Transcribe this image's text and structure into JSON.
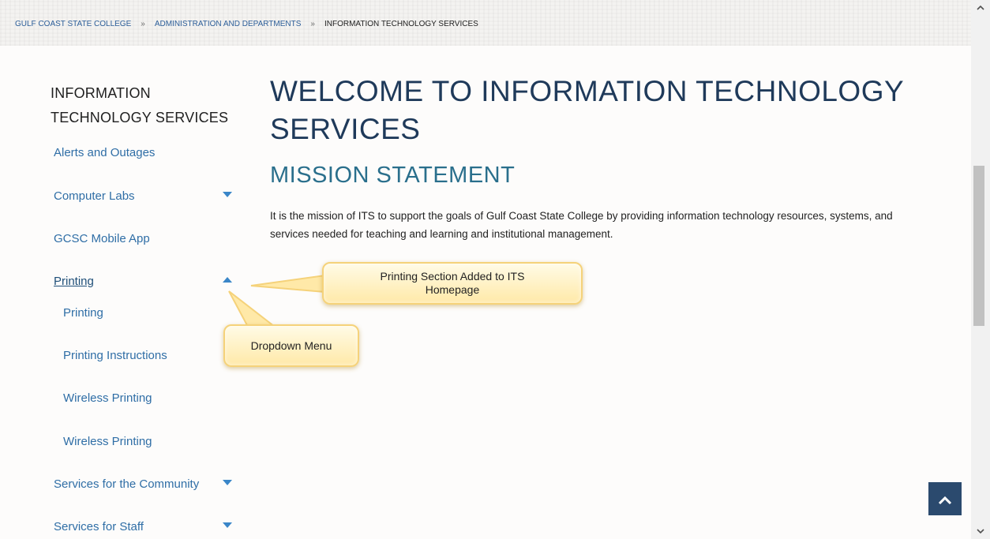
{
  "breadcrumb": {
    "items": [
      "GULF COAST STATE COLLEGE",
      "ADMINISTRATION AND DEPARTMENTS",
      "INFORMATION TECHNOLOGY SERVICES"
    ],
    "separator": "»"
  },
  "sidebar": {
    "title_line1": "INFORMATION",
    "title_line2": "TECHNOLOGY SERVICES",
    "items": [
      {
        "label": "Alerts and Outages"
      },
      {
        "label": "Computer Labs",
        "caret": "chevron-down-icon"
      },
      {
        "label": "GCSC Mobile App"
      },
      {
        "label": "Printing",
        "caret": "chevron-up-icon",
        "expanded": true
      },
      {
        "label": "Services for the Community",
        "caret": "chevron-down-icon"
      },
      {
        "label": "Services for Staff",
        "caret": "chevron-down-icon"
      }
    ],
    "subitems": [
      "Printing",
      "Printing Instructions",
      "Wireless Printing",
      "Wireless Printing"
    ]
  },
  "main": {
    "title": "WELCOME TO INFORMATION TECHNOLOGY SERVICES",
    "section_title": "MISSION STATEMENT",
    "mission_text": "It is the mission of ITS to support the goals of Gulf Coast State College by providing information technology resources, systems, and services needed for teaching and learning and institutional management."
  },
  "callouts": {
    "printing_section": "Printing Section Added to ITS Homepage",
    "dropdown": "Dropdown Menu"
  },
  "controls": {
    "back_to_top_icon": "chevron-up-icon",
    "scroll_up_icon": "scroll-up-arrow-icon",
    "scroll_down_icon": "scroll-down-arrow-icon"
  },
  "colors": {
    "link": "#2f6ea6",
    "heading": "#1f3a5a",
    "section_heading": "#2a6f8c",
    "caret": "#3a86c8",
    "callout_fill": "#ffe9a8",
    "back_to_top": "#2b4a6e"
  }
}
